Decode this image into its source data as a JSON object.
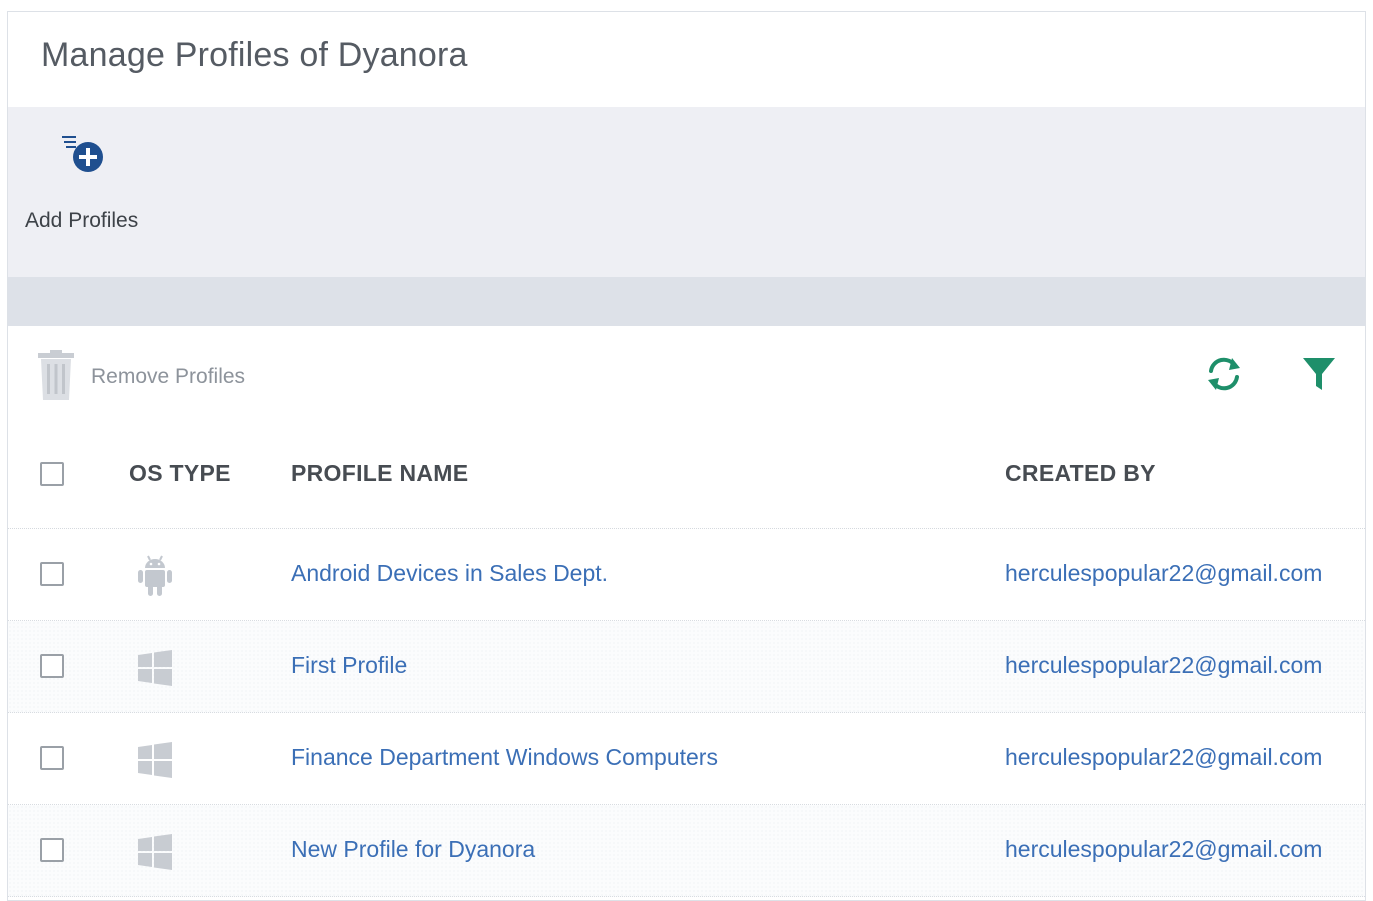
{
  "page": {
    "title": "Manage Profiles of Dyanora"
  },
  "toolbar": {
    "add_label": "Add Profiles"
  },
  "actions": {
    "remove_label": "Remove Profiles"
  },
  "table": {
    "headers": {
      "os_type": "OS TYPE",
      "profile_name": "PROFILE NAME",
      "created_by": "CREATED BY"
    },
    "rows": [
      {
        "os": "android-icon",
        "name": "Android Devices in Sales Dept.",
        "created_by": "herculespopular22@gmail.com"
      },
      {
        "os": "windows-icon",
        "name": "First Profile",
        "created_by": "herculespopular22@gmail.com"
      },
      {
        "os": "windows-icon",
        "name": "Finance Department Windows Computers",
        "created_by": "herculespopular22@gmail.com"
      },
      {
        "os": "windows-icon",
        "name": "New Profile for Dyanora",
        "created_by": "herculespopular22@gmail.com"
      }
    ]
  },
  "colors": {
    "accent": "#1e8f6a",
    "link": "#3b6fb6",
    "add_icon": "#1f4f8f",
    "toolbar_bg": "#eeeff4",
    "subbar_bg": "#dde1e8"
  }
}
